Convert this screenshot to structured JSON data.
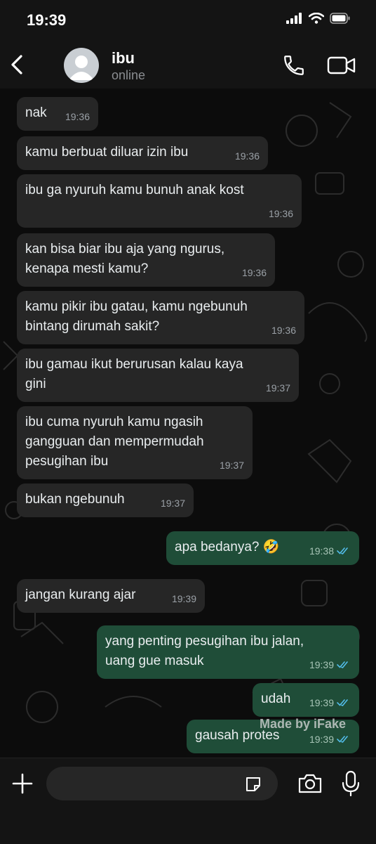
{
  "status_bar": {
    "time": "19:39",
    "icons": [
      "signal-icon",
      "wifi-icon",
      "battery-icon"
    ]
  },
  "header": {
    "contact_name": "ibu",
    "contact_status": "online",
    "icons": [
      "back-icon",
      "avatar-icon",
      "phone-icon",
      "video-call-icon"
    ]
  },
  "messages": [
    {
      "direction": "in",
      "text": "nak",
      "time": "19:36"
    },
    {
      "direction": "in",
      "text": "kamu berbuat diluar izin ibu",
      "time": "19:36"
    },
    {
      "direction": "in",
      "text": "ibu ga nyuruh kamu bunuh anak kost",
      "time": "19:36"
    },
    {
      "direction": "in",
      "text": "kan bisa biar ibu aja yang ngurus,\nkenapa mesti kamu?",
      "time": "19:36"
    },
    {
      "direction": "in",
      "text": "kamu pikir ibu gatau, kamu ngebunuh\nbintang dirumah sakit?",
      "time": "19:36"
    },
    {
      "direction": "in",
      "text": "ibu gamau ikut berurusan kalau kaya\ngini",
      "time": "19:37"
    },
    {
      "direction": "in",
      "text": "ibu cuma nyuruh kamu ngasih\ngangguan dan mempermudah\npesugihan ibu",
      "time": "19:37"
    },
    {
      "direction": "in",
      "text": "bukan ngebunuh",
      "time": "19:37"
    },
    {
      "direction": "out",
      "text": "apa bedanya? 🤣",
      "time": "19:38",
      "read": true
    },
    {
      "direction": "in",
      "text": "jangan kurang ajar",
      "time": "19:39"
    },
    {
      "direction": "out",
      "text": "yang penting pesugihan ibu jalan,\nuang gue masuk",
      "time": "19:39",
      "read": true
    },
    {
      "direction": "out",
      "text": "udah",
      "time": "19:39",
      "read": true
    },
    {
      "direction": "out",
      "text": "gausah protes",
      "time": "19:39",
      "read": true
    }
  ],
  "watermark": "Made by iFake",
  "input_bar": {
    "placeholder": "",
    "icons": [
      "plus-icon",
      "sticker-icon",
      "camera-icon",
      "mic-icon"
    ]
  },
  "colors": {
    "incoming_bubble": "#262626",
    "outgoing_bubble": "#1f4d38",
    "read_tick": "#53bdeb",
    "chat_background": "#0c0c0c"
  }
}
